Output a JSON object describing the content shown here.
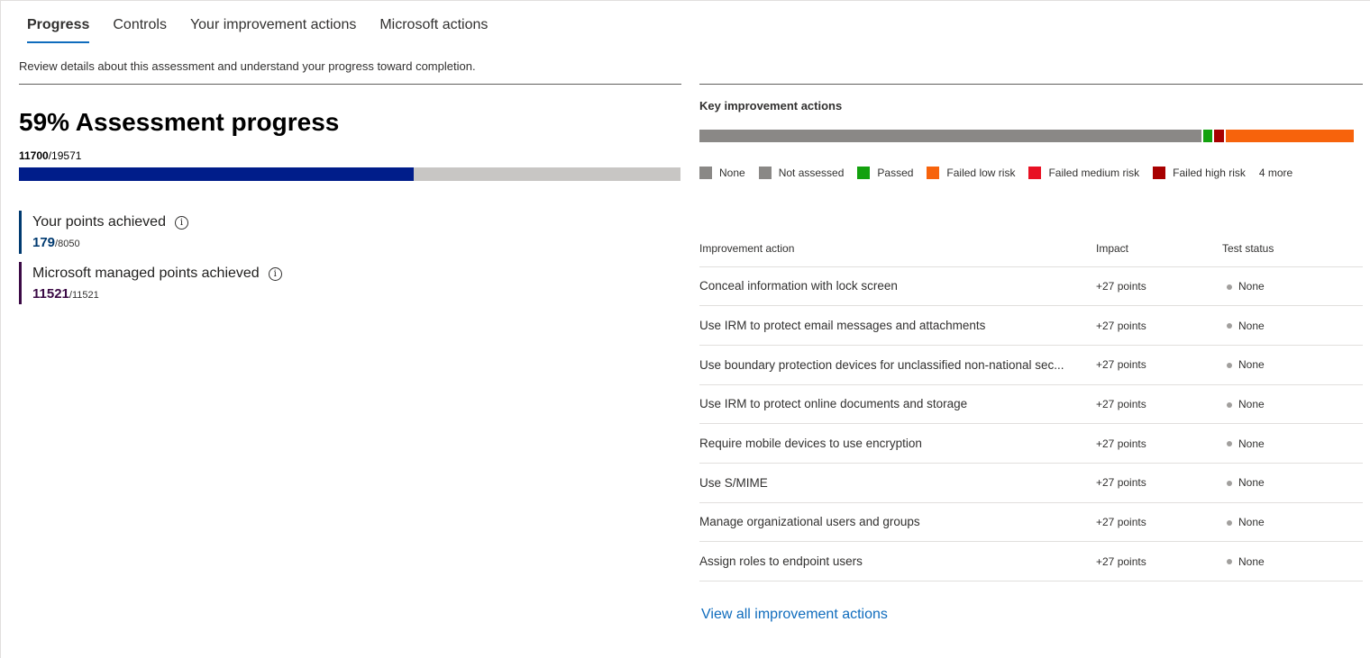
{
  "tabs": [
    {
      "label": "Progress",
      "active": true
    },
    {
      "label": "Controls"
    },
    {
      "label": "Your improvement actions"
    },
    {
      "label": "Microsoft actions"
    }
  ],
  "description": "Review details about this assessment and understand your progress toward completion.",
  "assessment": {
    "title": "59% Assessment progress",
    "achieved": "11700",
    "total": "/19571",
    "progress_fraction": 0.597
  },
  "points": {
    "yours": {
      "label": "Your points achieved",
      "value": "179",
      "total": "/8050"
    },
    "microsoft": {
      "label": "Microsoft managed points achieved",
      "value": "11521",
      "total": "/11521"
    }
  },
  "key_actions": {
    "title": "Key improvement actions",
    "bar_segments": [
      {
        "status": "Not assessed",
        "fraction": 0.761,
        "color": "#8a8886"
      },
      {
        "status": "Passed",
        "fraction": 0.016,
        "color": "#13a10e"
      },
      {
        "status": "Failed high risk",
        "fraction": 0.018,
        "color": "#a80000"
      },
      {
        "status": "Failed low risk",
        "fraction": 0.196,
        "color": "#f7630c"
      }
    ],
    "legend": [
      {
        "label": "None",
        "color": "#8a8886"
      },
      {
        "label": "Not assessed",
        "color": "#8a8886"
      },
      {
        "label": "Passed",
        "color": "#13a10e"
      },
      {
        "label": "Failed low risk",
        "color": "#f7630c"
      },
      {
        "label": "Failed medium risk",
        "color": "#e81123"
      },
      {
        "label": "Failed high risk",
        "color": "#a80000"
      }
    ],
    "more": "4 more"
  },
  "table": {
    "headers": [
      "Improvement action",
      "Impact",
      "Test status"
    ],
    "rows": [
      {
        "action": "Conceal information with lock screen",
        "impact": "+27 points",
        "status": "None"
      },
      {
        "action": "Use IRM to protect email messages and attachments",
        "impact": "+27 points",
        "status": "None"
      },
      {
        "action": "Use boundary protection devices for unclassified non-national sec...",
        "impact": "+27 points",
        "status": "None"
      },
      {
        "action": "Use IRM to protect online documents and storage",
        "impact": "+27 points",
        "status": "None"
      },
      {
        "action": "Require mobile devices to use encryption",
        "impact": "+27 points",
        "status": "None"
      },
      {
        "action": "Use S/MIME",
        "impact": "+27 points",
        "status": "None"
      },
      {
        "action": "Manage organizational users and groups",
        "impact": "+27 points",
        "status": "None"
      },
      {
        "action": "Assign roles to endpoint users",
        "impact": "+27 points",
        "status": "None"
      }
    ]
  },
  "view_all_label": "View all improvement actions"
}
